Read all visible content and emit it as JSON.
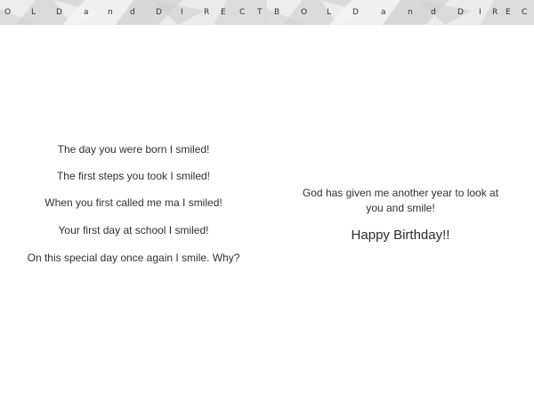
{
  "banner": {
    "left_letters": [
      "O",
      "L",
      "D",
      "a",
      "n",
      "d",
      "D",
      "I",
      "R",
      "E",
      "C",
      "T"
    ],
    "right_letters": [
      "B",
      "O",
      "L",
      "D",
      "a",
      "n",
      "d",
      "D",
      "I",
      "R",
      "E",
      "C"
    ]
  },
  "left_page": {
    "lines": [
      "The day you were born I smiled!",
      "The first steps you took I smiled!",
      "When you first called me ma I smiled!",
      "Your first day at school I smiled!",
      "On this special day once again I smile.  Why?"
    ]
  },
  "right_page": {
    "message": "God has given me another year to look at you and smile!",
    "greeting": "Happy Birthday!!"
  }
}
